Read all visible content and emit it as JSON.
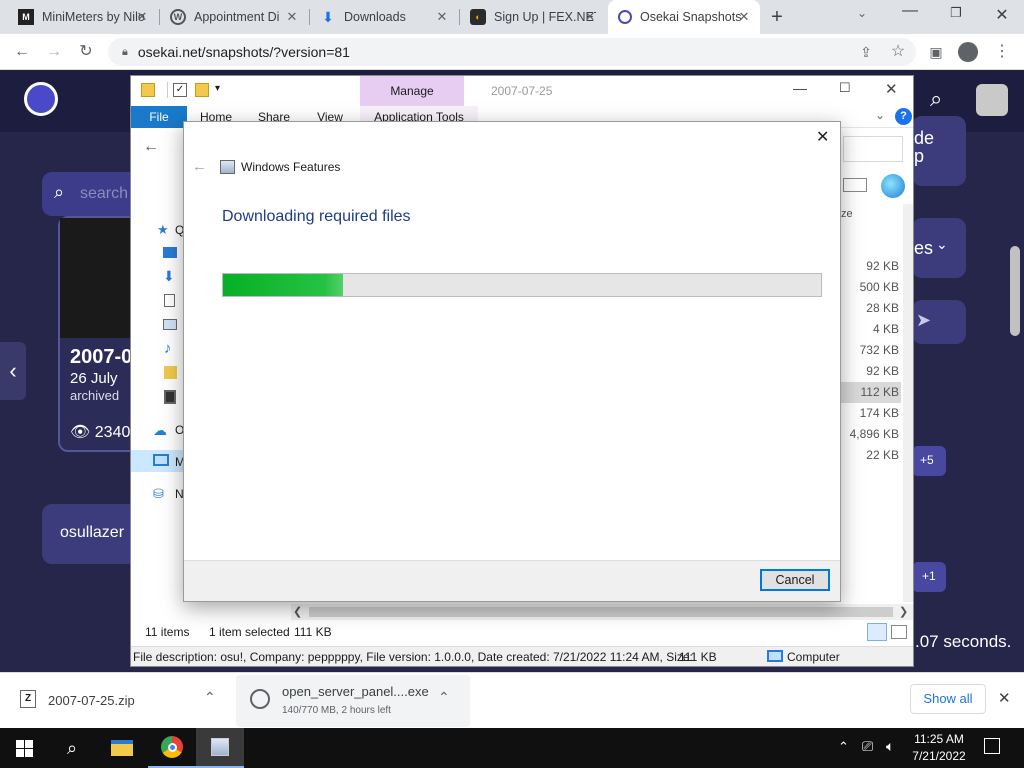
{
  "browser": {
    "tabs": [
      {
        "title": "MiniMeters by Nilo",
        "icon": "minimeters-icon",
        "active": false
      },
      {
        "title": "Appointment Di",
        "icon": "wordpress-icon",
        "active": false
      },
      {
        "title": "Downloads",
        "icon": "download-icon",
        "active": false
      },
      {
        "title": "Sign Up | FEX.NET",
        "icon": "fex-icon",
        "active": false
      },
      {
        "title": "Osekai Snapshots",
        "icon": "osekai-icon",
        "active": true
      }
    ],
    "new_tab_symbol": "+",
    "url": "osekai.net/snapshots/?version=81"
  },
  "site": {
    "search_placeholder": "search",
    "snapshot_title": "2007-0",
    "snapshot_date": "26 July",
    "snapshot_archived": "archived",
    "snapshot_views": "2340",
    "side_text_1": "de",
    "side_text_2": "p",
    "side_menu": "es",
    "badge_1": "+5",
    "badge_2": "+1",
    "user_label": "osullazer",
    "timing_text": ".07 seconds."
  },
  "explorer": {
    "context_tab": "Manage",
    "window_title": "2007-07-25",
    "ribbon_tabs": [
      "File",
      "Home",
      "Share",
      "View"
    ],
    "context_subtab": "Application Tools",
    "column_size": "ze",
    "sizes": [
      "92 KB",
      "500 KB",
      "28 KB",
      "4 KB",
      "732 KB",
      "92 KB",
      "112 KB",
      "174 KB",
      "4,896 KB",
      "22 KB"
    ],
    "selected_index": 6,
    "nav_labels": [
      "Q",
      "O",
      "M",
      "N"
    ],
    "status_items": "11 items",
    "status_selected": "1 item selected",
    "status_size": "111 KB",
    "details_bar": "File description: osu!, Company: pepppppy, File version: 1.0.0.0, Date created: 7/21/2022 11:24 AM, Size:",
    "details_size": "111 KB",
    "details_location": "Computer"
  },
  "dialog": {
    "title": "Windows Features",
    "heading": "Downloading required files",
    "progress_fraction": 0.2,
    "cancel_label": "Cancel"
  },
  "downloads_bar": {
    "items": [
      {
        "name": "2007-07-25.zip",
        "status": ""
      },
      {
        "name": "open_server_panel....exe",
        "status": "140/770 MB, 2 hours left"
      }
    ],
    "show_all_label": "Show all"
  },
  "taskbar": {
    "time": "11:25 AM",
    "date": "7/21/2022"
  },
  "colors": {
    "progress_green": "#06b025",
    "link_blue": "#1e3c8c",
    "site_bg": "#26264a"
  }
}
